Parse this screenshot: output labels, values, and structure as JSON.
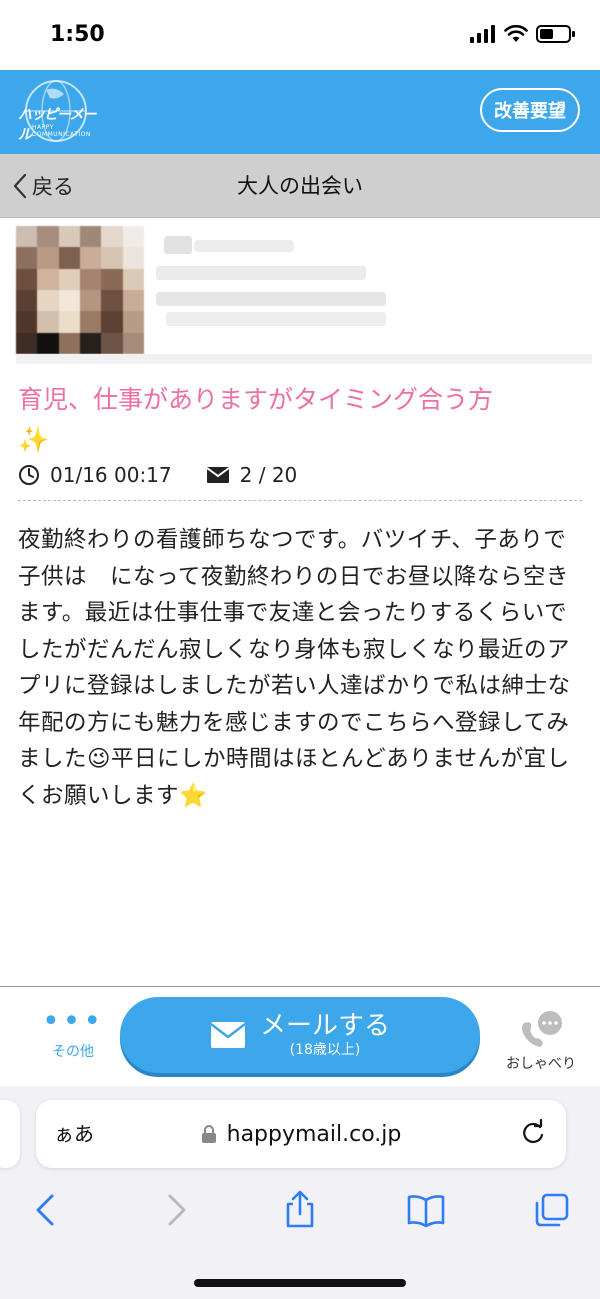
{
  "status_bar": {
    "time": "1:50"
  },
  "header": {
    "logo_text": "ハッピーメール",
    "logo_sub": "HAPPY COMMUNICATION",
    "feedback_label": "改善要望"
  },
  "nav": {
    "back_label": "戻る",
    "title": "大人の出会い"
  },
  "post": {
    "title": "育児、仕事がありますがタイミング合う方",
    "title_emoji": "✨",
    "datetime": "01/16 00:17",
    "mail_count": "2 / 20",
    "body": "夜勤終わりの看護師ちなつです。バツイチ、子ありで子供は　になって夜勤終わりの日でお昼以降なら空きます。最近は仕事仕事で友達と会ったりするくらいでしたがだんだん寂しくなり身体も寂しくなり最近のアプリに登録はしましたが若い人達ばかりで私は紳士な年配の方にも魅力を感じますのでこちらへ登録してみました😉平日にしか時間はほとんどありませんが宜しくお願いします⭐"
  },
  "action_bar": {
    "other_label": "その他",
    "mail_label": "メールする",
    "mail_sub": "(18歳以上)",
    "chat_label": "おしゃべり"
  },
  "browser": {
    "aa_label": "ぁあ",
    "url": "happymail.co.jp"
  },
  "colors": {
    "brand_blue": "#3ca7ea",
    "title_pink": "#ec6fa5",
    "nav_gray": "#cfcfcf"
  }
}
